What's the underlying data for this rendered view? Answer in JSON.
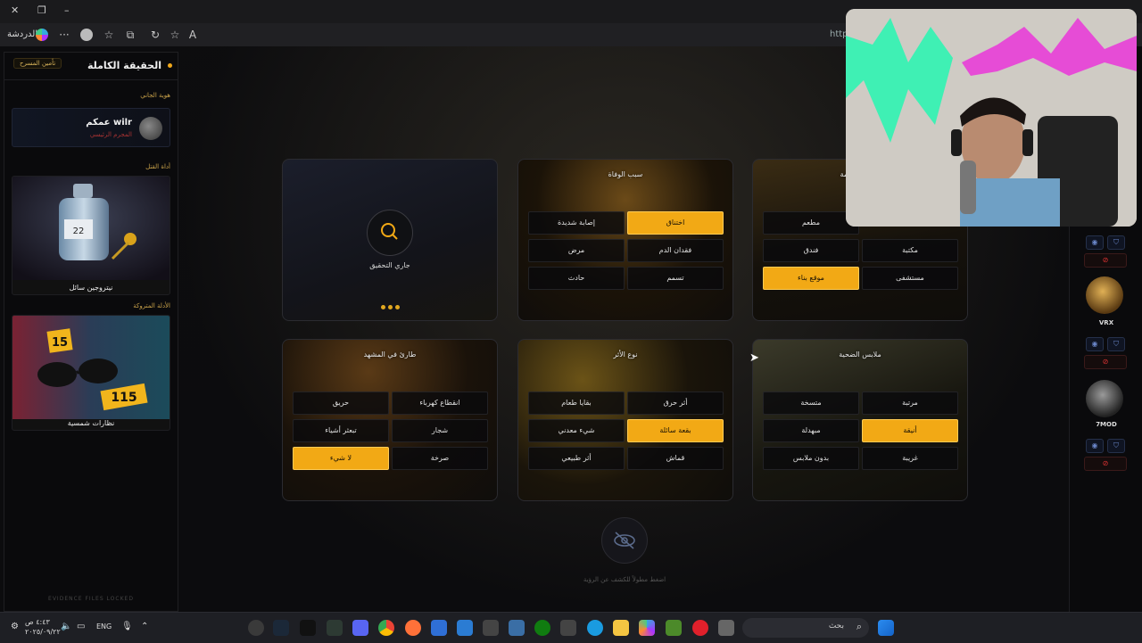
{
  "browser": {
    "chat_label": "الدردشة",
    "address_partial": "http",
    "window_controls": [
      "close-icon",
      "restore-icon",
      "minimize-icon"
    ]
  },
  "sidebar": {
    "title": "الحقيقة الكاملة",
    "badge": "تأمين المسرح",
    "killer_section": "هوية الجاني",
    "killer_name": "عمكم wilr",
    "killer_role": "المجرم الرئيسي",
    "weapon_section": "أداة القتل",
    "weapon_name": "نيتروجين سائل",
    "evidence_section": "الأدلة المتروكة",
    "evidence_name": "نظارات شمسية",
    "footer": "EVIDENCE FILES LOCKED"
  },
  "search_card": {
    "status": "جاري التحقيق"
  },
  "cards": {
    "cause": {
      "title": "سبب الوفاة",
      "options": [
        "إصابة شديدة",
        "اختناق",
        "مرض",
        "فقدان الدم",
        "حادث",
        "تسمم"
      ],
      "selected": "اختناق"
    },
    "location": {
      "title": "مكان الجريمة",
      "options": [
        "مطعم",
        "مكتبة",
        "فندق",
        "موقع بناء",
        "مستشفى"
      ],
      "selected": "موقع بناء"
    },
    "scene": {
      "title": "طارئ في المشهد",
      "options": [
        "حريق",
        "انقطاع كهرباء",
        "تبعثر أشياء",
        "شجار",
        "لا شيء",
        "صرخة"
      ],
      "selected": "لا شيء"
    },
    "trace": {
      "title": "نوع الأثر",
      "options": [
        "بقايا طعام",
        "أثر حرق",
        "شيء معدني",
        "بقعة سائلة",
        "أثر طبيعي",
        "قماش"
      ],
      "selected": "بقعة سائلة"
    },
    "clothes": {
      "title": "ملابس الضحية",
      "options": [
        "متسخة",
        "مرتبة",
        "مبهدلة",
        "أنيقة",
        "بدون ملابس",
        "غريبة"
      ],
      "selected": "أنيقة"
    }
  },
  "reveal": {
    "hint": "اضغط مطولاً للكشف عن الرؤية"
  },
  "right_panel": {
    "players": [
      {
        "name": "VRX"
      },
      {
        "name": "7MOD"
      }
    ]
  },
  "taskbar": {
    "search_label": "بحث",
    "lang": "ENG",
    "time": "٤:٤٣ ص",
    "date": "٢٠٢٥/٠٩/٢٢"
  },
  "colors": {
    "accent": "#f2a915",
    "danger": "#d33333",
    "panel_bg": "#0a0a0c"
  }
}
